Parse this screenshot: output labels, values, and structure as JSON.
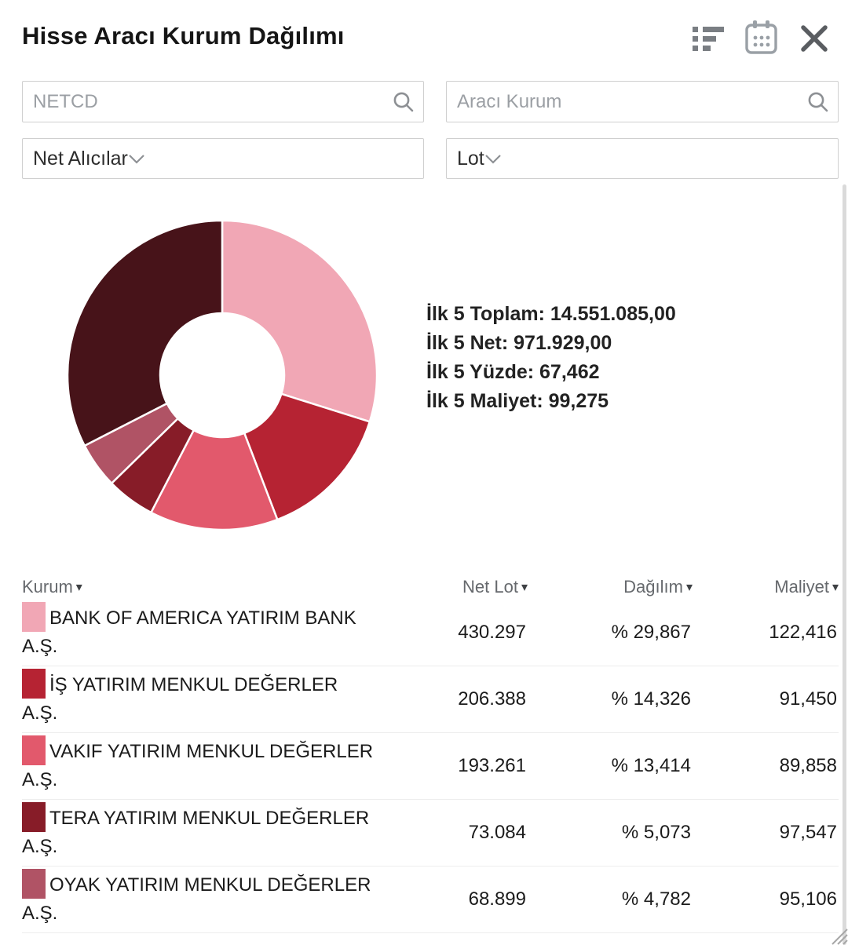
{
  "header": {
    "title": "Hisse Aracı Kurum Dağılımı",
    "icons": [
      "list-view-icon",
      "calendar-icon",
      "close-icon"
    ]
  },
  "filters": {
    "symbol_input": {
      "value": "NETCD",
      "icon": "search-icon"
    },
    "broker_input": {
      "placeholder": "Aracı Kurum",
      "icon": "search-icon"
    },
    "side_select": {
      "value": "Net Alıcılar",
      "icon": "chevron-down-icon"
    },
    "unit_select": {
      "value": "Lot",
      "icon": "chevron-down-icon"
    }
  },
  "stats": {
    "lines": [
      "İlk 5 Toplam: 14.551.085,00",
      "İlk 5 Net: 971.929,00",
      "İlk 5 Yüzde: 67,462",
      "İlk 5 Maliyet: 99,275"
    ]
  },
  "chart_data": {
    "type": "pie",
    "subtype": "donut",
    "title": "",
    "unit": "percent",
    "start_angle_deg": 0,
    "direction": "clockwise",
    "inner_radius_ratio": 0.4,
    "legend_position": "table-below",
    "series": [
      {
        "name": "BANK OF AMERICA YATIRIM BANK A.Ş.",
        "value": 29.867,
        "color": "#f1a7b5"
      },
      {
        "name": "İŞ YATIRIM MENKUL DEĞERLER A.Ş.",
        "value": 14.326,
        "color": "#b62333"
      },
      {
        "name": "VAKIF YATIRIM MENKUL DEĞERLER A.Ş.",
        "value": 13.414,
        "color": "#e2596c"
      },
      {
        "name": "TERA YATIRIM MENKUL DEĞERLER A.Ş.",
        "value": 5.073,
        "color": "#871c28"
      },
      {
        "name": "OYAK YATIRIM MENKUL DEĞERLER A.Ş.",
        "value": 4.782,
        "color": "#b05365"
      },
      {
        "name": "",
        "value": 32.538,
        "color": "#471319"
      }
    ]
  },
  "table": {
    "sort_indicator": "▾",
    "columns": [
      {
        "label": "Kurum"
      },
      {
        "label": "Net Lot"
      },
      {
        "label": "Dağılım"
      },
      {
        "label": "Maliyet"
      }
    ],
    "rows": [
      {
        "kurum_line1": "BANK OF AMERICA YATIRIM BANK",
        "kurum_line2": "A.Ş.",
        "color": "#f1a7b5",
        "net_lot": "430.297",
        "dagilim": "% 29,867",
        "maliyet": "122,416"
      },
      {
        "kurum_line1": "İŞ YATIRIM MENKUL DEĞERLER",
        "kurum_line2": "A.Ş.",
        "color": "#b62333",
        "net_lot": "206.388",
        "dagilim": "% 14,326",
        "maliyet": "91,450"
      },
      {
        "kurum_line1": "VAKIF YATIRIM MENKUL DEĞERLER",
        "kurum_line2": "A.Ş.",
        "color": "#e2596c",
        "net_lot": "193.261",
        "dagilim": "% 13,414",
        "maliyet": "89,858"
      },
      {
        "kurum_line1": "TERA YATIRIM MENKUL DEĞERLER",
        "kurum_line2": "A.Ş.",
        "color": "#871c28",
        "net_lot": "73.084",
        "dagilim": "% 5,073",
        "maliyet": "97,547"
      },
      {
        "kurum_line1": "OYAK YATIRIM MENKUL DEĞERLER",
        "kurum_line2": "A.Ş.",
        "color": "#b05365",
        "net_lot": "68.899",
        "dagilim": "% 4,782",
        "maliyet": "95,106"
      }
    ]
  }
}
